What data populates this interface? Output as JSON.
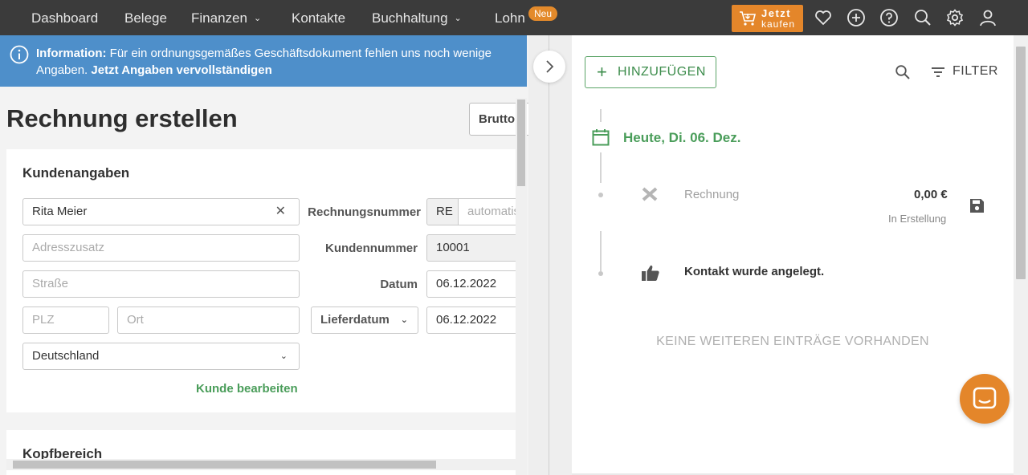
{
  "nav": {
    "items": [
      {
        "label": "Dashboard"
      },
      {
        "label": "Belege"
      },
      {
        "label": "Finanzen"
      },
      {
        "label": "Kontakte"
      },
      {
        "label": "Buchhaltung"
      },
      {
        "label": "Lohn"
      }
    ],
    "badge": "Neu",
    "cta_line1": "Jetzt",
    "cta_line2": "kaufen"
  },
  "info": {
    "prefix": "Information:",
    "text": " Für ein ordnungsgemäßes Geschäftsdokument fehlen uns noch wenige Angaben. ",
    "link": "Jetzt Angaben vervollständigen"
  },
  "page": {
    "title": "Rechnung erstellen",
    "brutto": "Brutto"
  },
  "customer": {
    "section_title": "Kundenangaben",
    "name": "Rita Meier",
    "address_extra_placeholder": "Adresszusatz",
    "street_placeholder": "Straße",
    "zip_placeholder": "PLZ",
    "city_placeholder": "Ort",
    "country": "Deutschland",
    "edit_link": "Kunde bearbeiten"
  },
  "invoice": {
    "number_label": "Rechnungsnummer",
    "number_prefix": "RE",
    "number_placeholder": "automatisch",
    "customer_no_label": "Kundennummer",
    "customer_no": "10001",
    "date_label": "Datum",
    "date": "06.12.2022",
    "delivery_label": "Lieferdatum",
    "delivery_date": "06.12.2022"
  },
  "header_section": {
    "title": "Kopfbereich"
  },
  "timeline": {
    "add_label": "HINZUFÜGEN",
    "filter_label": "FILTER",
    "today": "Heute, Di. 06. Dez.",
    "entry_doc": "Rechnung",
    "entry_amount": "0,00 €",
    "entry_status": "In Erstellung",
    "entry_contact": "Kontakt wurde angelegt.",
    "empty": "KEINE WEITEREN EINTRÄGE VORHANDEN"
  },
  "colors": {
    "accent_orange": "#e4862a",
    "info_blue": "#4e8fca",
    "green": "#4a9d5a",
    "nav_bg": "#3b3b3b"
  }
}
